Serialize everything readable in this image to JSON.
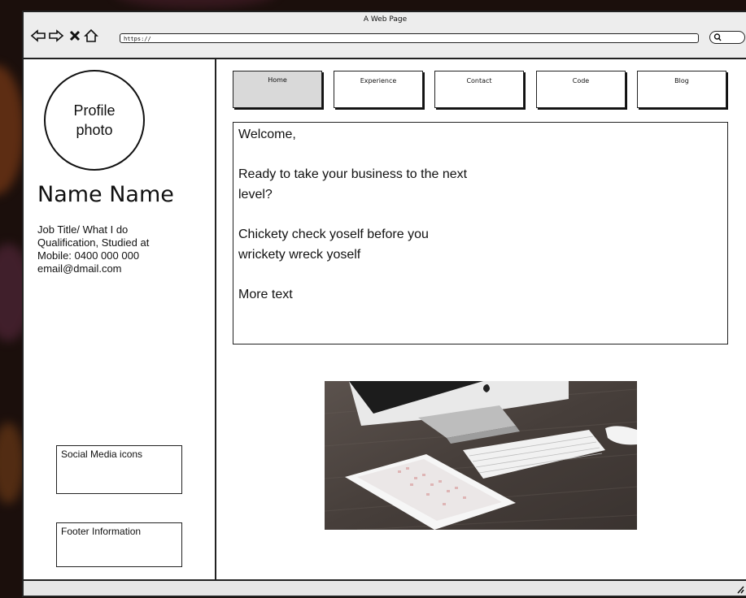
{
  "browser": {
    "title": "A Web Page",
    "url": "https://",
    "nav_icons": [
      "back-arrow-icon",
      "forward-arrow-icon",
      "close-icon",
      "home-icon"
    ],
    "search_icon": "search-icon"
  },
  "sidebar": {
    "profile_photo": "Profile photo",
    "name": "Name Name",
    "info": [
      "Job Title/ What I do",
      "Qualification, Studied at",
      "Mobile: 0400 000 000",
      "email@dmail.com"
    ],
    "social": "Social Media icons",
    "footer": "Footer Information"
  },
  "nav": {
    "tabs": [
      "Home",
      "Experience",
      "Contact",
      "Code",
      "Blog"
    ],
    "active": "Home"
  },
  "content": {
    "greeting": "Welcome,",
    "line1": "Ready to take your business to the next",
    "line2": "level?",
    "line3": "Chickety check yoself before you",
    "line4": "wrickety wreck yoself",
    "line5": "More text"
  },
  "colors": {
    "outline": "#222222",
    "chrome_bg": "#ededed",
    "active_tab": "#d9d9d9"
  }
}
